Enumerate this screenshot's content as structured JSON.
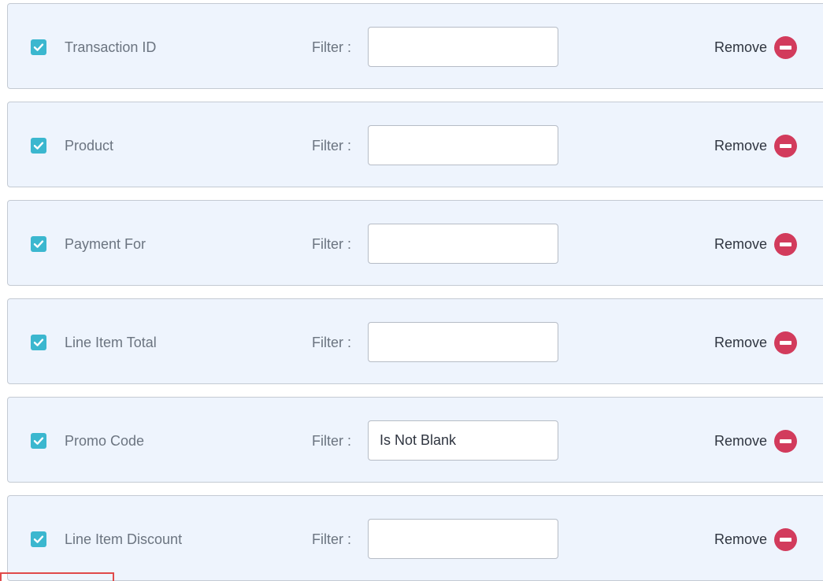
{
  "rows": [
    {
      "label": "Transaction ID",
      "filter_label": "Filter :",
      "filter_value": "",
      "checked": true,
      "remove_label": "Remove"
    },
    {
      "label": "Product",
      "filter_label": "Filter :",
      "filter_value": "",
      "checked": true,
      "remove_label": "Remove"
    },
    {
      "label": "Payment For",
      "filter_label": "Filter :",
      "filter_value": "",
      "checked": true,
      "remove_label": "Remove"
    },
    {
      "label": "Line Item Total",
      "filter_label": "Filter :",
      "filter_value": "",
      "checked": true,
      "remove_label": "Remove"
    },
    {
      "label": "Promo Code",
      "filter_label": "Filter :",
      "filter_value": "Is Not Blank",
      "checked": true,
      "remove_label": "Remove"
    },
    {
      "label": "Line Item Discount",
      "filter_label": "Filter :",
      "filter_value": "",
      "checked": true,
      "remove_label": "Remove"
    }
  ],
  "icons": {
    "checkbox": "check-icon",
    "remove": "minus-circle-icon"
  },
  "colors": {
    "row_background": "#eef4fd",
    "checkbox": "#3bb7cf",
    "remove_icon": "#d23b5c",
    "highlight": "#e04a4a"
  }
}
